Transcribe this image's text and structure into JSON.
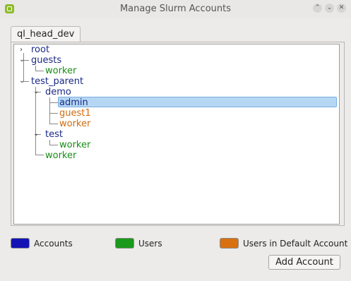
{
  "window": {
    "title": "Manage Slurm Accounts",
    "controls": [
      "chevron-up-icon",
      "chevron-down-icon",
      "close-icon"
    ]
  },
  "tabs": [
    {
      "label": "ql_head_dev",
      "active": true
    }
  ],
  "tree": {
    "root": "root",
    "guests": "guests",
    "guests_worker": "worker",
    "test_parent": "test_parent",
    "demo": "demo",
    "demo_admin": "admin",
    "demo_guest1": "guest1",
    "demo_worker": "worker",
    "test": "test",
    "test_worker": "worker",
    "tp_worker": "worker",
    "selected": "admin"
  },
  "legend": {
    "accounts": {
      "label": "Accounts",
      "color": "#1414b4"
    },
    "users": {
      "label": "Users",
      "color": "#1a9a1a"
    },
    "default_users": {
      "label": "Users in Default Account",
      "color": "#d9700f"
    }
  },
  "colors": {
    "account": "#1b2a87",
    "user": "#178d17",
    "default_user": "#cf6c0d"
  },
  "buttons": {
    "add_account": "Add Account"
  }
}
